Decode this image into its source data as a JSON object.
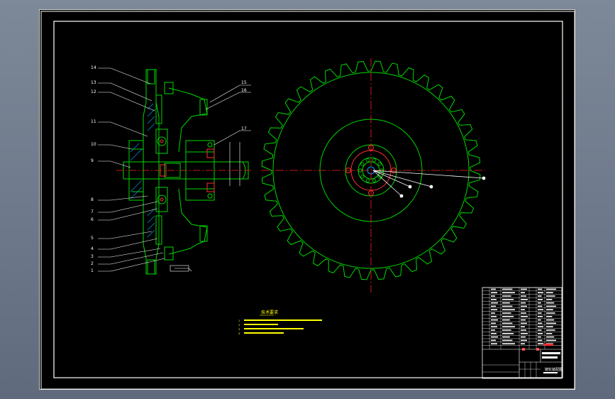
{
  "colors": {
    "background": "#000000",
    "frame": "#ffffff",
    "part": "#00d800",
    "centerline": "#ff2020",
    "leader": "#ffffff",
    "note_text": "#ffff00",
    "hatch": "#00a0ff"
  },
  "part_numbers": [
    "1",
    "2",
    "3",
    "4",
    "5",
    "6",
    "7",
    "8",
    "9",
    "10",
    "11",
    "12",
    "13",
    "14",
    "15",
    "16",
    "17"
  ],
  "notes": {
    "title": "技术要求",
    "lines": [
      "1",
      "2",
      "3",
      "4"
    ]
  },
  "title_block": {
    "drawing_name": "链轮装配图",
    "material": "",
    "scale": "",
    "sheet": ""
  }
}
